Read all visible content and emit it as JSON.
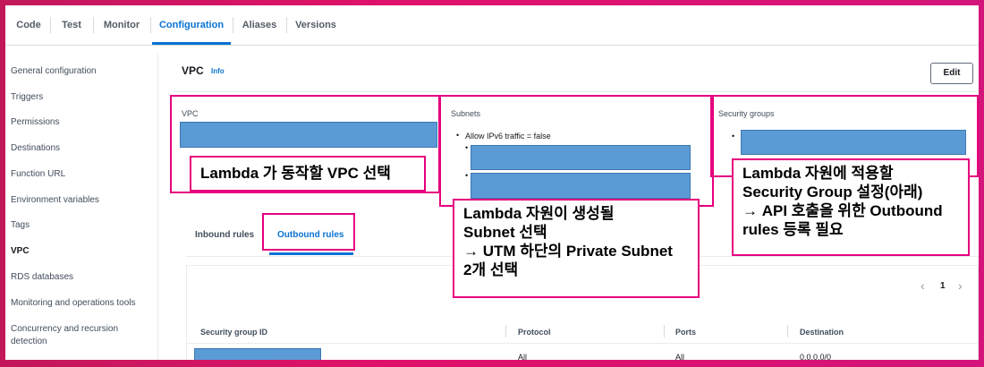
{
  "tabs": [
    "Code",
    "Test",
    "Monitor",
    "Configuration",
    "Aliases",
    "Versions"
  ],
  "active_tab": "Configuration",
  "sidebar": {
    "items": [
      {
        "label": "General configuration"
      },
      {
        "label": "Triggers"
      },
      {
        "label": "Permissions"
      },
      {
        "label": "Destinations"
      },
      {
        "label": "Function URL"
      },
      {
        "label": "Environment variables"
      },
      {
        "label": "Tags"
      },
      {
        "label": "VPC",
        "active": true
      },
      {
        "label": "RDS databases"
      },
      {
        "label": "Monitoring and operations tools"
      },
      {
        "label": "Concurrency and recursion detection"
      }
    ]
  },
  "vpc": {
    "title": "VPC",
    "info": "Info",
    "edit_label": "Edit",
    "vpc_label": "VPC",
    "subnets_label": "Subnets",
    "subnets_ipv6": "Allow IPv6 traffic = false",
    "security_groups_label": "Security groups"
  },
  "rules": {
    "inbound_tab": "Inbound rules",
    "outbound_tab": "Outbound rules",
    "page": "1",
    "columns": [
      "Security group ID",
      "Protocol",
      "Ports",
      "Destination"
    ],
    "row": {
      "protocol": "All",
      "ports": "All",
      "destination": "0.0.0.0/0"
    }
  },
  "annotations": {
    "vpc_note": "Lambda 가 동작할 VPC 선택",
    "subnet_note": "Lambda 자원이 생성될\nSubnet 선택\n→ UTM 하단의 Private Subnet\n2개 선택",
    "sg_note": "Lambda 자원에 적용할\nSecurity Group 설정(아래)\n→ API 호출을 위한 Outbound\nrules 등록 필요"
  },
  "colors": {
    "accent": "#0972d3",
    "annotation": "#e6007e",
    "redacted": "#5b9bd5"
  }
}
